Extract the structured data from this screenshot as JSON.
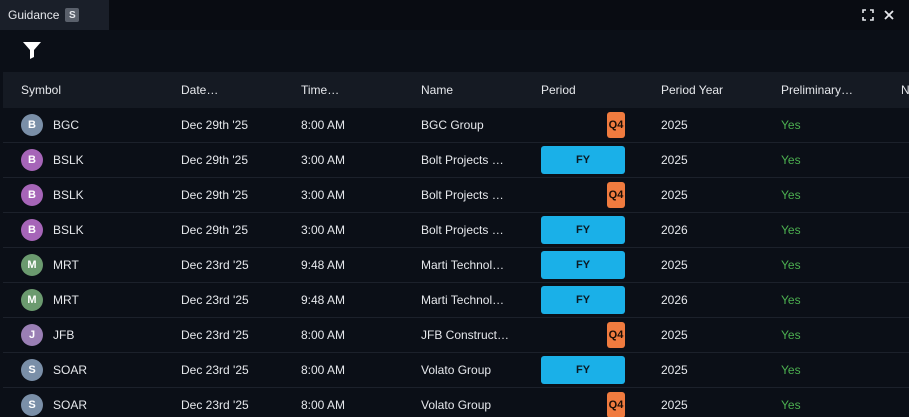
{
  "tab": {
    "title": "Guidance",
    "badge": "S"
  },
  "window": {
    "maximize_icon": "maximize-icon",
    "close_icon": "close-icon"
  },
  "toolbar": {
    "filter_icon": "filter-icon"
  },
  "columns": [
    "Symbol",
    "Date…",
    "Time…",
    "Name",
    "Period",
    "Period Year",
    "Preliminary…",
    "N"
  ],
  "colors": {
    "fy_pill": "#1ab0e8",
    "q4_pill": "#f07b3f",
    "preliminary_yes": "#4caf50",
    "avatar_blue_grey": "#7a8fa8",
    "avatar_purple": "#a665b8",
    "avatar_green": "#6b9a6f",
    "avatar_lavender": "#9a7fb5"
  },
  "rows": [
    {
      "avatar": "B",
      "avatar_color": "#7a8fa8",
      "symbol": "BGC",
      "date": "Dec 29th '25",
      "time": "8:00 AM",
      "name": "BGC Group",
      "period": "Q4",
      "year": "2025",
      "preliminary": "Yes"
    },
    {
      "avatar": "B",
      "avatar_color": "#a665b8",
      "symbol": "BSLK",
      "date": "Dec 29th '25",
      "time": "3:00 AM",
      "name": "Bolt Projects …",
      "period": "FY",
      "year": "2025",
      "preliminary": "Yes"
    },
    {
      "avatar": "B",
      "avatar_color": "#a665b8",
      "symbol": "BSLK",
      "date": "Dec 29th '25",
      "time": "3:00 AM",
      "name": "Bolt Projects …",
      "period": "Q4",
      "year": "2025",
      "preliminary": "Yes"
    },
    {
      "avatar": "B",
      "avatar_color": "#a665b8",
      "symbol": "BSLK",
      "date": "Dec 29th '25",
      "time": "3:00 AM",
      "name": "Bolt Projects …",
      "period": "FY",
      "year": "2026",
      "preliminary": "Yes"
    },
    {
      "avatar": "M",
      "avatar_color": "#6b9a6f",
      "symbol": "MRT",
      "date": "Dec 23rd '25",
      "time": "9:48 AM",
      "name": "Marti Technol…",
      "period": "FY",
      "year": "2025",
      "preliminary": "Yes"
    },
    {
      "avatar": "M",
      "avatar_color": "#6b9a6f",
      "symbol": "MRT",
      "date": "Dec 23rd '25",
      "time": "9:48 AM",
      "name": "Marti Technol…",
      "period": "FY",
      "year": "2026",
      "preliminary": "Yes"
    },
    {
      "avatar": "J",
      "avatar_color": "#9a7fb5",
      "symbol": "JFB",
      "date": "Dec 23rd '25",
      "time": "8:00 AM",
      "name": "JFB Construct…",
      "period": "Q4",
      "year": "2025",
      "preliminary": "Yes"
    },
    {
      "avatar": "S",
      "avatar_color": "#7a8fa8",
      "symbol": "SOAR",
      "date": "Dec 23rd '25",
      "time": "8:00 AM",
      "name": "Volato Group",
      "period": "FY",
      "year": "2025",
      "preliminary": "Yes"
    },
    {
      "avatar": "S",
      "avatar_color": "#7a8fa8",
      "symbol": "SOAR",
      "date": "Dec 23rd '25",
      "time": "8:00 AM",
      "name": "Volato Group",
      "period": "Q4",
      "year": "2025",
      "preliminary": "Yes"
    }
  ]
}
